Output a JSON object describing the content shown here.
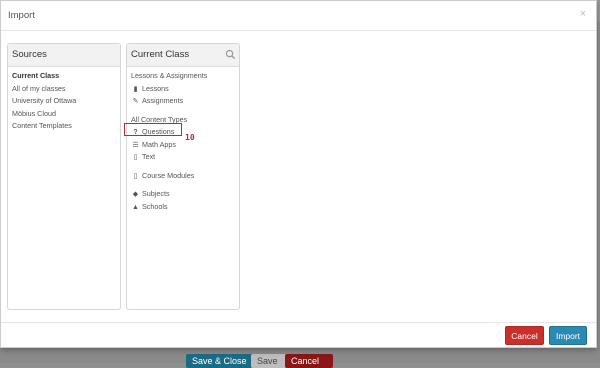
{
  "background": {
    "buttons": [
      "Save & Close",
      "Save",
      "Cancel"
    ]
  },
  "modal": {
    "title": "Import",
    "close_label": "×"
  },
  "sources": {
    "heading": "Sources",
    "items": [
      {
        "label": "Current Class",
        "selected": true
      },
      {
        "label": "All of my classes"
      },
      {
        "label": "University of Ottawa"
      },
      {
        "label": "Möbius Cloud"
      },
      {
        "label": "Content Templates"
      }
    ]
  },
  "current_class": {
    "heading": "Current Class",
    "group1_label": "Lessons & Assignments",
    "group1_items": [
      {
        "label": "Lessons",
        "icon": "book-icon"
      },
      {
        "label": "Assignments",
        "icon": "pencil-icon"
      }
    ],
    "group2_label": "All Content Types",
    "group2_items": [
      {
        "label": "Questions",
        "icon": "question-icon"
      },
      {
        "label": "Math Apps",
        "icon": "sliders-icon"
      },
      {
        "label": "Text",
        "icon": "document-icon"
      }
    ],
    "group3_items": [
      {
        "label": "Course Modules",
        "icon": "module-icon"
      }
    ],
    "group4_items": [
      {
        "label": "Subjects",
        "icon": "tag-icon"
      },
      {
        "label": "Schools",
        "icon": "graduation-cap-icon"
      }
    ]
  },
  "annotation": {
    "number": "10"
  },
  "footer": {
    "cancel_label": "Cancel",
    "import_label": "Import"
  },
  "colors": {
    "cancel": "#c9302c",
    "import": "#2a8ab3",
    "highlight": "#a0343c"
  }
}
